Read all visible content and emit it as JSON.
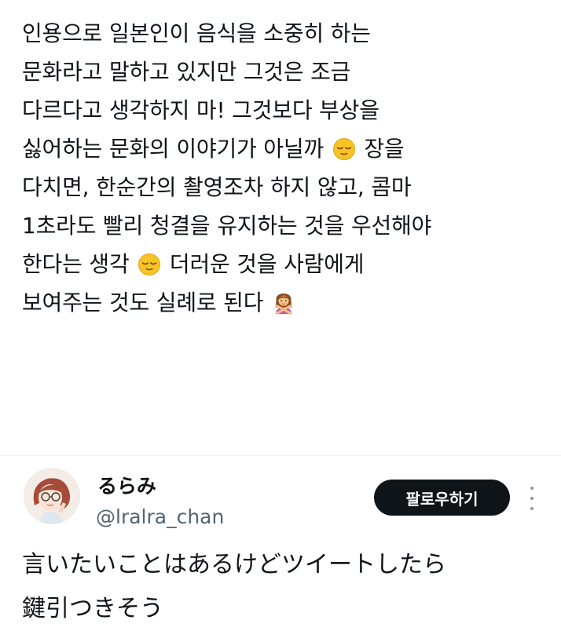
{
  "post": {
    "lines": [
      "인용으로 일본인이 음식을 소중히 하는",
      "문화라고 말하고 있지만 그것은 조금",
      "다르다고 생각하지 마! 그것보다 부상을",
      "싫어하는 문화의 이야기가 아닐까",
      "장을",
      "다치면, 한순간의 촬영조차 하지 않고, 콤마",
      "1초라도 빨리 청결을 유지하는 것을 우선해야",
      "한다는 생각",
      "더러운 것을 사람에게",
      "보여주는 것도 실례로 된다"
    ],
    "emojis": [
      "relieved-face",
      "relieved-face",
      "person-gesturing-no"
    ]
  },
  "user": {
    "display_name": "るらみ",
    "handle": "@lralra_chan",
    "follow_label": "팔로우하기"
  },
  "reply": {
    "lines": [
      "言いたいことはあるけどツイートしたら",
      "鍵引つきそう"
    ]
  },
  "colors": {
    "text": "#0f1419",
    "secondary": "#536471",
    "button_bg": "#0f1419",
    "button_text": "#ffffff",
    "divider": "#eff3f4",
    "emoji_yellow": "#f7c325"
  }
}
